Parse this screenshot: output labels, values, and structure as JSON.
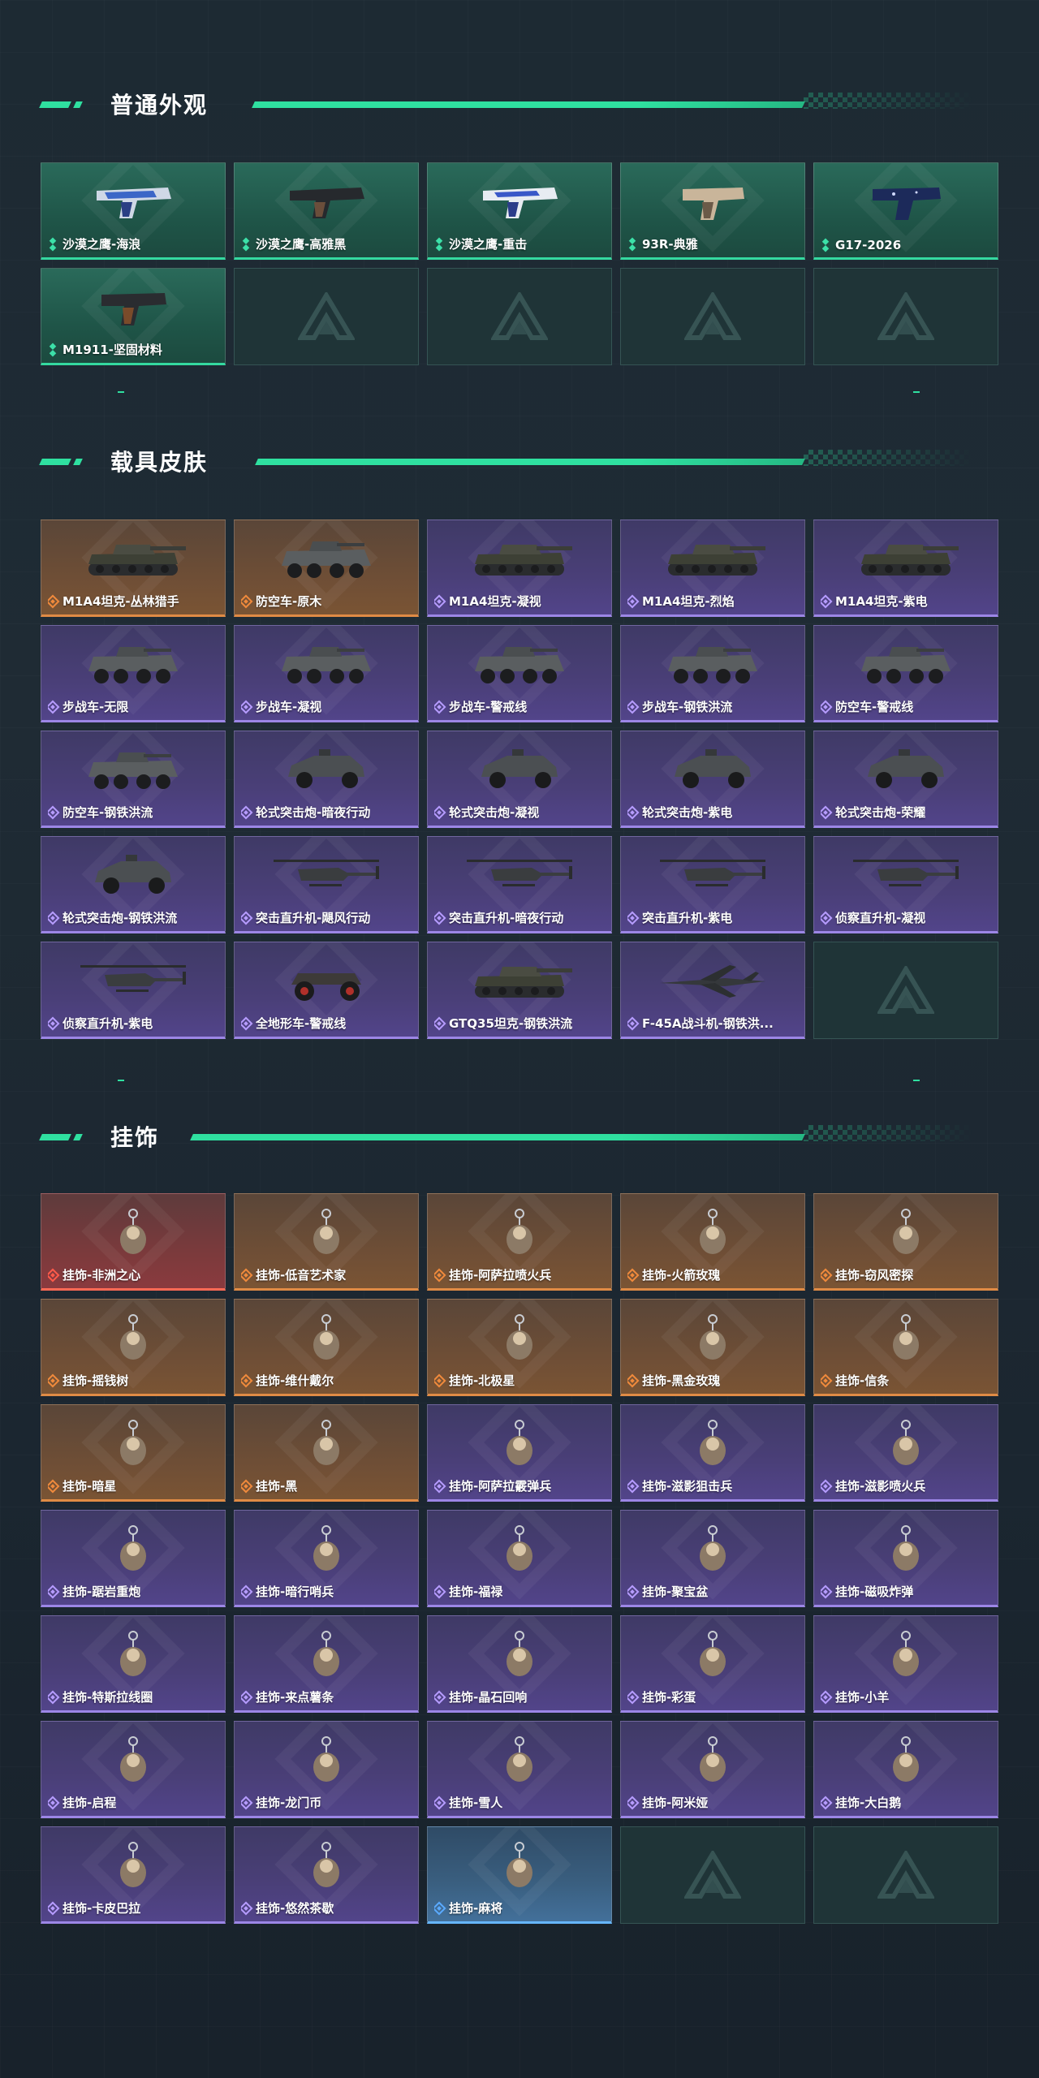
{
  "sections": [
    {
      "title": "普通外观",
      "items": [
        {
          "label": "沙漠之鹰-海浪",
          "rarity": "green",
          "kind": "pistol-blue"
        },
        {
          "label": "沙漠之鹰-高雅黑",
          "rarity": "green",
          "kind": "pistol-dark"
        },
        {
          "label": "沙漠之鹰-重击",
          "rarity": "green",
          "kind": "pistol-white"
        },
        {
          "label": "93R-典雅",
          "rarity": "green",
          "kind": "pistol-tan"
        },
        {
          "label": "G17-2026",
          "rarity": "green",
          "kind": "pistol-navy"
        },
        {
          "label": "M1911-坚固材料",
          "rarity": "green",
          "kind": "pistol-wood"
        },
        {
          "label": "",
          "rarity": "empty"
        },
        {
          "label": "",
          "rarity": "empty"
        },
        {
          "label": "",
          "rarity": "empty"
        },
        {
          "label": "",
          "rarity": "empty"
        }
      ]
    },
    {
      "title": "载具皮肤",
      "items": [
        {
          "label": "M1A4坦克-丛林猎手",
          "rarity": "orange",
          "kind": "tank"
        },
        {
          "label": "防空车-原木",
          "rarity": "orange",
          "kind": "apc"
        },
        {
          "label": "M1A4坦克-凝视",
          "rarity": "purple",
          "kind": "tank"
        },
        {
          "label": "M1A4坦克-烈焰",
          "rarity": "purple",
          "kind": "tank"
        },
        {
          "label": "M1A4坦克-紫电",
          "rarity": "purple",
          "kind": "tank"
        },
        {
          "label": "步战车-无限",
          "rarity": "purple",
          "kind": "apc"
        },
        {
          "label": "步战车-凝视",
          "rarity": "purple",
          "kind": "apc"
        },
        {
          "label": "步战车-警戒线",
          "rarity": "purple",
          "kind": "apc"
        },
        {
          "label": "步战车-钢铁洪流",
          "rarity": "purple",
          "kind": "apc"
        },
        {
          "label": "防空车-警戒线",
          "rarity": "purple",
          "kind": "apc"
        },
        {
          "label": "防空车-钢铁洪流",
          "rarity": "purple",
          "kind": "apc"
        },
        {
          "label": "轮式突击炮-暗夜行动",
          "rarity": "purple",
          "kind": "car"
        },
        {
          "label": "轮式突击炮-凝视",
          "rarity": "purple",
          "kind": "car"
        },
        {
          "label": "轮式突击炮-紫电",
          "rarity": "purple",
          "kind": "car"
        },
        {
          "label": "轮式突击炮-荣耀",
          "rarity": "purple",
          "kind": "car"
        },
        {
          "label": "轮式突击炮-钢铁洪流",
          "rarity": "purple",
          "kind": "car"
        },
        {
          "label": "突击直升机-飓风行动",
          "rarity": "purple",
          "kind": "heli"
        },
        {
          "label": "突击直升机-暗夜行动",
          "rarity": "purple",
          "kind": "heli"
        },
        {
          "label": "突击直升机-紫电",
          "rarity": "purple",
          "kind": "heli"
        },
        {
          "label": "侦察直升机-凝视",
          "rarity": "purple",
          "kind": "heli"
        },
        {
          "label": "侦察直升机-紫电",
          "rarity": "purple",
          "kind": "heli"
        },
        {
          "label": "全地形车-警戒线",
          "rarity": "purple",
          "kind": "atv"
        },
        {
          "label": "GTQ35坦克-钢铁洪流",
          "rarity": "purple",
          "kind": "tank"
        },
        {
          "label": "F-45A战斗机-钢铁洪...",
          "rarity": "purple",
          "kind": "jet"
        },
        {
          "label": "",
          "rarity": "empty"
        }
      ]
    },
    {
      "title": "挂饰",
      "items": [
        {
          "label": "挂饰-非洲之心",
          "rarity": "red",
          "kind": "charm"
        },
        {
          "label": "挂饰-低音艺术家",
          "rarity": "orange",
          "kind": "charm"
        },
        {
          "label": "挂饰-阿萨拉喷火兵",
          "rarity": "orange",
          "kind": "charm"
        },
        {
          "label": "挂饰-火箭玫瑰",
          "rarity": "orange",
          "kind": "charm"
        },
        {
          "label": "挂饰-窃风密探",
          "rarity": "orange",
          "kind": "charm"
        },
        {
          "label": "挂饰-摇钱树",
          "rarity": "orange",
          "kind": "charm"
        },
        {
          "label": "挂饰-维什戴尔",
          "rarity": "orange",
          "kind": "charm"
        },
        {
          "label": "挂饰-北极星",
          "rarity": "orange",
          "kind": "charm"
        },
        {
          "label": "挂饰-黑金玫瑰",
          "rarity": "orange",
          "kind": "charm"
        },
        {
          "label": "挂饰-信条",
          "rarity": "orange",
          "kind": "charm"
        },
        {
          "label": "挂饰-暗星",
          "rarity": "orange",
          "kind": "charm"
        },
        {
          "label": "挂饰-黑",
          "rarity": "orange",
          "kind": "charm"
        },
        {
          "label": "挂饰-阿萨拉霰弹兵",
          "rarity": "purple",
          "kind": "charm"
        },
        {
          "label": "挂饰-滋影狙击兵",
          "rarity": "purple",
          "kind": "charm"
        },
        {
          "label": "挂饰-滋影喷火兵",
          "rarity": "purple",
          "kind": "charm"
        },
        {
          "label": "挂饰-踞岩重炮",
          "rarity": "purple",
          "kind": "charm"
        },
        {
          "label": "挂饰-暗行哨兵",
          "rarity": "purple",
          "kind": "charm"
        },
        {
          "label": "挂饰-福禄",
          "rarity": "purple",
          "kind": "charm"
        },
        {
          "label": "挂饰-聚宝盆",
          "rarity": "purple",
          "kind": "charm"
        },
        {
          "label": "挂饰-磁吸炸弹",
          "rarity": "purple",
          "kind": "charm"
        },
        {
          "label": "挂饰-特斯拉线圈",
          "rarity": "purple",
          "kind": "charm"
        },
        {
          "label": "挂饰-来点薯条",
          "rarity": "purple",
          "kind": "charm"
        },
        {
          "label": "挂饰-晶石回响",
          "rarity": "purple",
          "kind": "charm"
        },
        {
          "label": "挂饰-彩蛋",
          "rarity": "purple",
          "kind": "charm"
        },
        {
          "label": "挂饰-小羊",
          "rarity": "purple",
          "kind": "charm"
        },
        {
          "label": "挂饰-启程",
          "rarity": "purple",
          "kind": "charm"
        },
        {
          "label": "挂饰-龙门币",
          "rarity": "purple",
          "kind": "charm"
        },
        {
          "label": "挂饰-雪人",
          "rarity": "purple",
          "kind": "charm"
        },
        {
          "label": "挂饰-阿米娅",
          "rarity": "purple",
          "kind": "charm"
        },
        {
          "label": "挂饰-大白鹅",
          "rarity": "purple",
          "kind": "charm"
        },
        {
          "label": "挂饰-卡皮巴拉",
          "rarity": "purple",
          "kind": "charm"
        },
        {
          "label": "挂饰-悠然茶歇",
          "rarity": "purple",
          "kind": "charm"
        },
        {
          "label": "挂饰-麻将",
          "rarity": "blue",
          "kind": "charm"
        },
        {
          "label": "",
          "rarity": "empty"
        },
        {
          "label": "",
          "rarity": "empty"
        }
      ]
    }
  ],
  "colors": {
    "accent": "#2fe0a0",
    "green": "#34d9a0",
    "orange": "#e08b45",
    "purple": "#9c86e6",
    "red": "#ff6a55",
    "blue": "#66b6ff"
  }
}
